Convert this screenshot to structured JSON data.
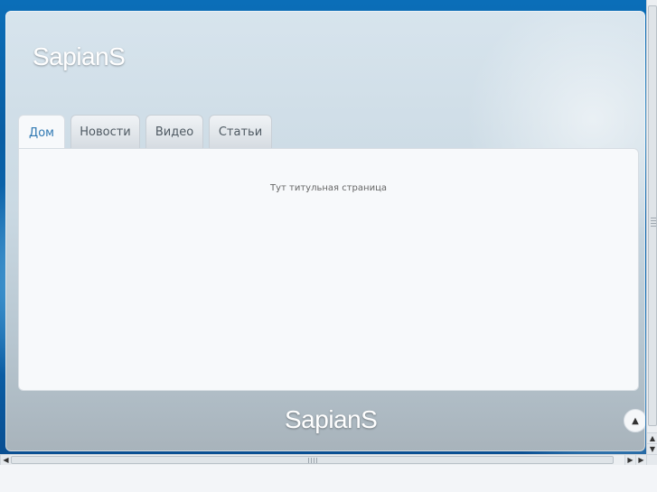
{
  "site": {
    "logo_text": "SapianS",
    "footer_logo_text": "SapianS"
  },
  "tabs": [
    {
      "label": "Дом",
      "active": true
    },
    {
      "label": "Новости",
      "active": false
    },
    {
      "label": "Видео",
      "active": false
    },
    {
      "label": "Статьи",
      "active": false
    }
  ],
  "panel": {
    "text": "Тут титульная страница"
  },
  "controls": {
    "scroll_top_icon": "triangle-up-icon",
    "up_arrow_icon": "arrow-up-icon",
    "down_arrow_icon": "arrow-down-icon",
    "left_arrow_icon": "arrow-left-icon",
    "right_arrow_icon": "arrow-right-icon"
  },
  "colors": {
    "active_tab_text": "#2f78b2",
    "tab_text": "#4e5962",
    "panel_bg": "#f7f9fb",
    "bg_blue": "#0b6eb8"
  }
}
